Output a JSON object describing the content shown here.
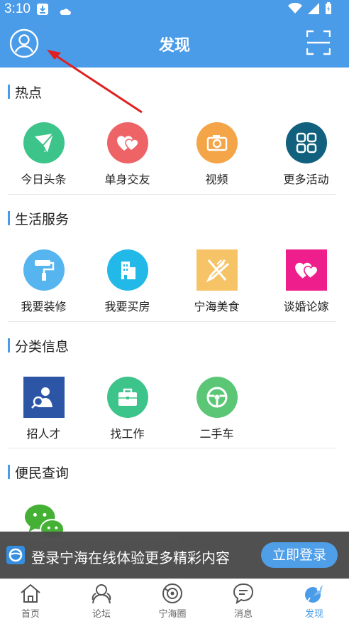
{
  "status_bar": {
    "time": "3:10"
  },
  "header": {
    "title": "发现"
  },
  "sections": [
    {
      "title": "热点",
      "items": [
        {
          "label": "今日头条",
          "icon": "paper-plane-icon",
          "color": "#3dc48a"
        },
        {
          "label": "单身交友",
          "icon": "hearts-icon",
          "color": "#ee6466"
        },
        {
          "label": "视频",
          "icon": "camera-icon",
          "color": "#f3a548"
        },
        {
          "label": "更多活动",
          "icon": "grid-icon",
          "color": "#11607e"
        }
      ]
    },
    {
      "title": "生活服务",
      "items": [
        {
          "label": "我要装修",
          "icon": "paint-roller-icon",
          "color": "#56b4ef"
        },
        {
          "label": "我要买房",
          "icon": "building-icon",
          "color": "#22b8e8"
        },
        {
          "label": "宁海美食",
          "icon": "utensils-icon",
          "color": "#f6c467"
        },
        {
          "label": "谈婚论嫁",
          "icon": "hearts-icon",
          "color": "#ee1f8c"
        }
      ]
    },
    {
      "title": "分类信息",
      "items": [
        {
          "label": "招人才",
          "icon": "recruit-icon",
          "color": "#2d55a6"
        },
        {
          "label": "找工作",
          "icon": "briefcase-icon",
          "color": "#3dc48a"
        },
        {
          "label": "二手车",
          "icon": "steering-wheel-icon",
          "color": "#5bc776"
        }
      ]
    },
    {
      "title": "便民查询",
      "items": [
        {
          "label": "",
          "icon": "wechat-icon",
          "color": "#44b135"
        }
      ]
    }
  ],
  "login_banner": {
    "message": "登录宁海在线体验更多精彩内容",
    "button": "立即登录"
  },
  "tabbar": {
    "tabs": [
      {
        "label": "首页",
        "icon": "home-icon"
      },
      {
        "label": "论坛",
        "icon": "forum-icon"
      },
      {
        "label": "宁海圈",
        "icon": "circle-icon"
      },
      {
        "label": "消息",
        "icon": "message-icon"
      },
      {
        "label": "发现",
        "icon": "rocket-icon",
        "active": true
      }
    ]
  },
  "colors": {
    "brand": "#4a9be8",
    "annotation_arrow": "#e02020"
  }
}
